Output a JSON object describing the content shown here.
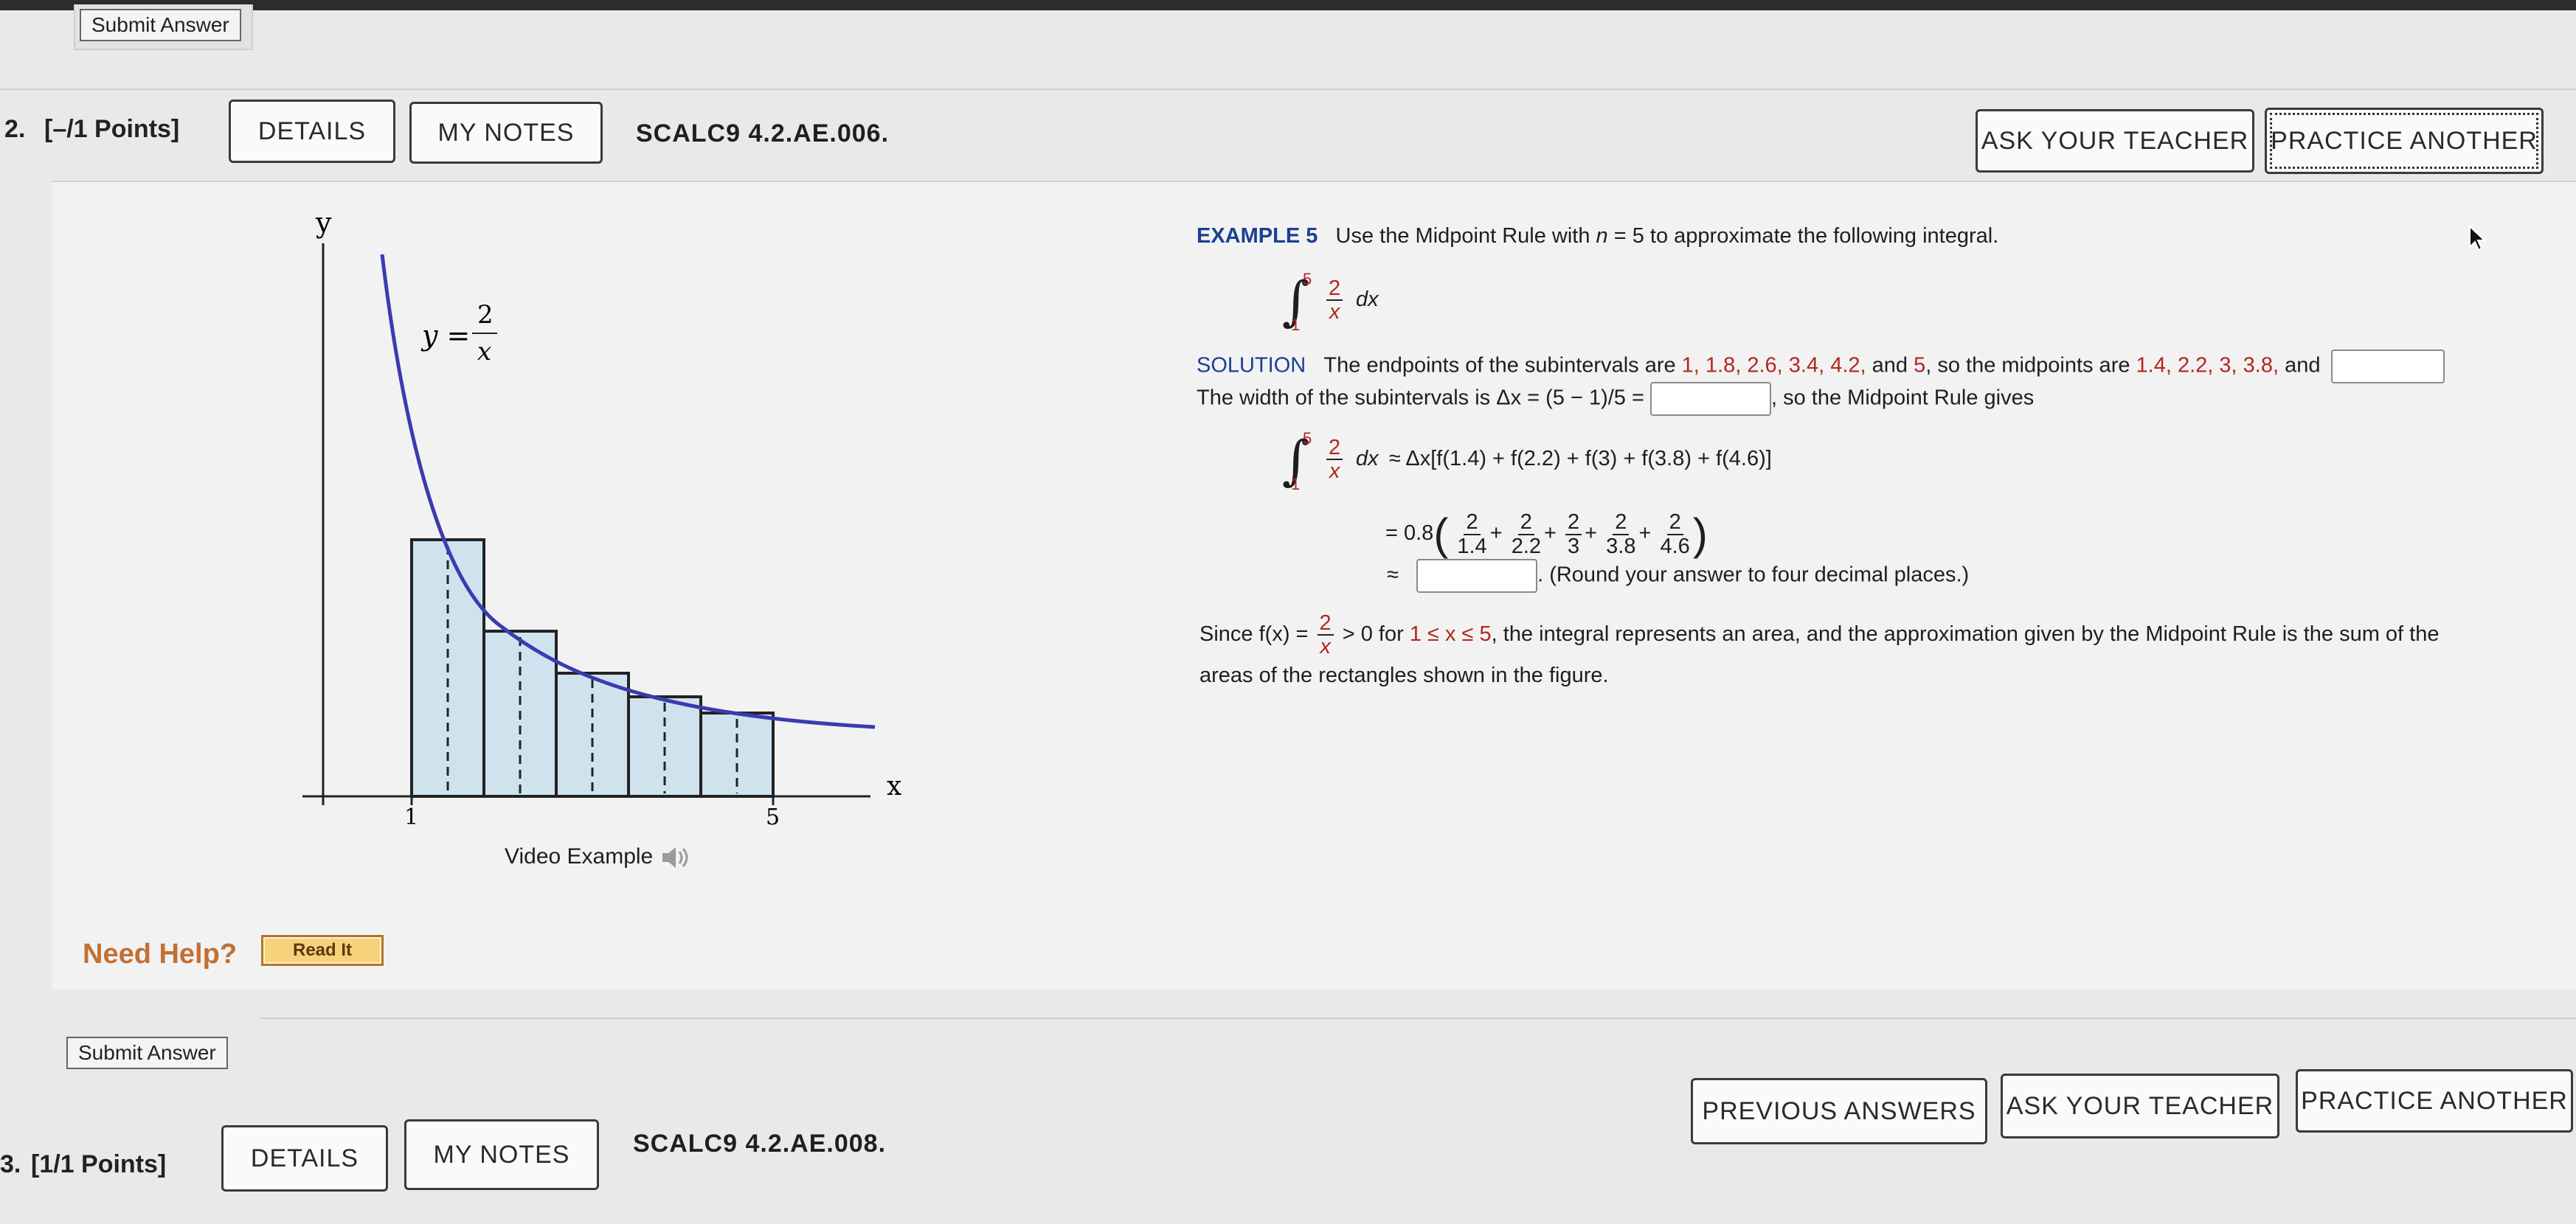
{
  "top": {
    "submit_label": "Submit Answer"
  },
  "q2": {
    "number": "2.",
    "points": "[–/1 Points]",
    "details": "DETAILS",
    "my_notes": "MY NOTES",
    "code": "SCALC9 4.2.AE.006.",
    "ask_teacher": "ASK YOUR TEACHER",
    "practice_another": "PRACTICE ANOTHER"
  },
  "graph": {
    "y_axis": "y",
    "x_axis": "x",
    "curve_lhs": "y =",
    "curve_num": "2",
    "curve_den": "x",
    "tick_1": "1",
    "tick_5": "5",
    "video_label": "Video Example"
  },
  "example": {
    "label": "EXAMPLE 5",
    "intro_a": "Use the Midpoint Rule with ",
    "intro_n": "n",
    "intro_b": " = 5 to approximate the following integral.",
    "upper": "5",
    "lower": "1",
    "num": "2",
    "den": "x",
    "dx": "dx",
    "solution_label": "SOLUTION",
    "sol_a": "The endpoints of the subintervals are ",
    "endpoints": "1, 1.8, 2.6, 3.4, 4.2,",
    "sol_b": " and ",
    "endpoint_last": "5",
    "sol_c": ", so the midpoints are ",
    "midpoints": "1.4, 2.2, 3, 3.8,",
    "sol_d": " and",
    "width_a": "The width of the subintervals is Δx = (5 − 1)/5 =",
    "width_b": ", so the Midpoint Rule gives",
    "rhs1": "≈ Δx[f(1.4) + f(2.2) + f(3) + f(3.8) + f(4.6)]",
    "eq2_prefix": "= 0.8",
    "denoms": [
      "1.4",
      "2.2",
      "3",
      "3.8",
      "4.6"
    ],
    "plus": "+",
    "approx": "≈",
    "round_note": ". (Round your answer to four decimal places.)",
    "since_a": "Since f(x) =",
    "since_b": "> 0 for",
    "since_range": "1 ≤ x ≤ 5",
    "since_c": ", the integral represents an area, and the approximation given by the Midpoint Rule is the sum of the",
    "since_d": "areas of the rectangles shown in the figure."
  },
  "help": {
    "label": "Need Help?",
    "read_it": "Read It"
  },
  "bottom_submit": "Submit Answer",
  "q3_buttons": {
    "previous_answers": "PREVIOUS ANSWERS",
    "ask_teacher": "ASK YOUR TEACHER",
    "practice_another": "PRACTICE ANOTHER"
  },
  "q3": {
    "number": "3.",
    "points": "[1/1 Points]",
    "details": "DETAILS",
    "my_notes": "MY NOTES",
    "code": "SCALC9 4.2.AE.008."
  },
  "colors": {
    "curve": "#3b3bb0",
    "rect_fill": "#cfe3ef",
    "accent_red": "#b3261e",
    "navy": "#1c3f94",
    "help_orange": "#c37033"
  }
}
